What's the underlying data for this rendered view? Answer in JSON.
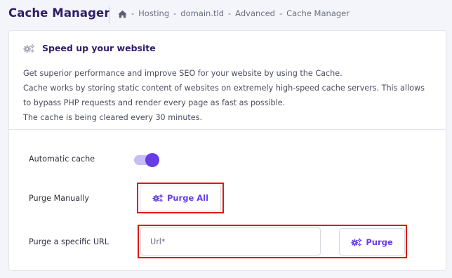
{
  "header": {
    "title": "Cache Manager",
    "breadcrumb": [
      "Hosting",
      "domain.tld",
      "Advanced",
      "Cache Manager"
    ],
    "separator": "-",
    "home_icon": "home-icon"
  },
  "card": {
    "title": "Speed up your website",
    "icon": "gears-icon",
    "description": [
      "Get superior performance and improve SEO for your website by using the Cache.",
      "Cache works by storing static content of websites on extremely high-speed cache servers. This allows",
      "to bypass PHP requests and render every page as fast as possible.",
      "The cache is being cleared every 30 minutes."
    ]
  },
  "settings": {
    "automatic_cache": {
      "label": "Automatic cache",
      "enabled": true
    },
    "purge_manually": {
      "label": "Purge Manually",
      "button_label": "Purge All"
    },
    "purge_url": {
      "label": "Purge a specific URL",
      "placeholder": "Url*",
      "value": "",
      "button_label": "Purge"
    }
  },
  "colors": {
    "accent": "#673de6",
    "toggle_track": "#c7bcf4",
    "title_text": "#2f1c6a",
    "highlight": "#e01616",
    "background": "#f4f5fa"
  }
}
